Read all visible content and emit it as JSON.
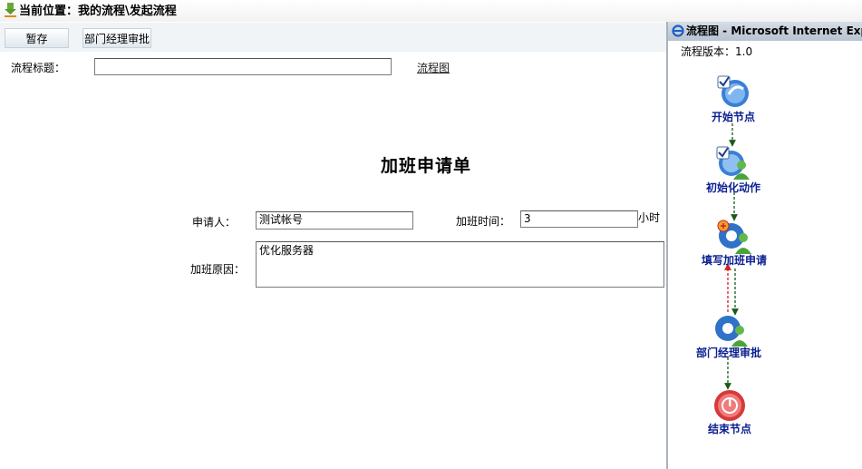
{
  "breadcrumb": {
    "text": "当前位置：我的流程\\发起流程"
  },
  "toolbar": {
    "save_label": "暂存",
    "step_label": "部门经理审批"
  },
  "title_row": {
    "label": "流程标题：",
    "value": "",
    "link": "流程图"
  },
  "form": {
    "title": "加班申请单",
    "applicant_label": "申请人：",
    "applicant_value": "测试帐号",
    "time_label": "加班时间：",
    "time_value": "3",
    "time_unit": "小时",
    "reason_label": "加班原因：",
    "reason_value": "优化服务器"
  },
  "flow_window": {
    "title": "流程图 - Microsoft Internet Explorer",
    "version": "流程版本：1.0",
    "nodes": [
      {
        "label": "开始节点",
        "icon": "start-node-icon"
      },
      {
        "label": "初始化动作",
        "icon": "init-action-icon"
      },
      {
        "label": "填写加班申请",
        "icon": "fill-form-icon"
      },
      {
        "label": "部门经理审批",
        "icon": "approval-icon"
      },
      {
        "label": "结束节点",
        "icon": "end-node-icon"
      }
    ],
    "colors": {
      "edge_green": "#1a5a1a",
      "edge_red": "#cc2222",
      "label": "#0a1f8f"
    }
  }
}
